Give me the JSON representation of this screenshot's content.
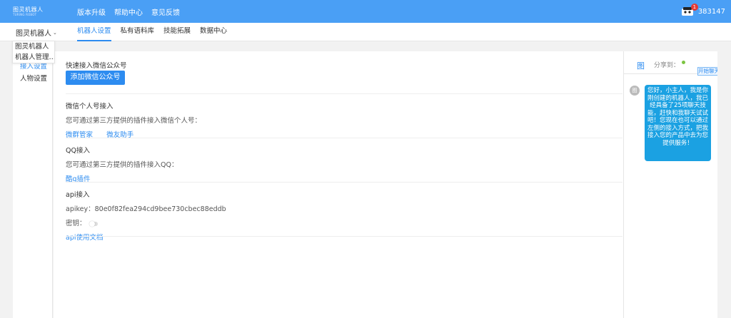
{
  "topbar": {
    "logo_line1": "图灵机器人",
    "logo_line2": "TURING ROBOT",
    "nav": [
      "版本升级",
      "帮助中心",
      "意见反馈"
    ],
    "badge_count": "1",
    "user_id": "383147",
    "bg_color": "#4a9ff5"
  },
  "subbar": {
    "robot_name": "图灵机器人",
    "tabs": [
      "机器人设置",
      "私有语料库",
      "技能拓展",
      "数据中心"
    ],
    "active_tab": "机器人设置"
  },
  "robot_dropdown": {
    "items": [
      "图灵机器人",
      "机器人管理…"
    ]
  },
  "sidebar": {
    "items": [
      "接入设置",
      "人物设置"
    ]
  },
  "main": {
    "wechat_official": {
      "title": "快速接入微信公众号",
      "button": "添加微信公众号"
    },
    "wechat_personal": {
      "title": "微信个人号接入",
      "desc": "您可通过第三方提供的插件接入微信个人号：",
      "links": [
        "微群管家",
        "微友助手"
      ]
    },
    "qq": {
      "title": "QQ接入",
      "desc": "您可通过第三方提供的插件接入QQ：",
      "link": "酷q插件"
    },
    "api": {
      "title": "api接入",
      "apikey_label": "apikey：",
      "apikey_value": "80e0f82fea294cd9bee730cbec88eddb",
      "secret_label": "密钥：",
      "doc_link": "api使用文档"
    }
  },
  "chat": {
    "logo_char": "图",
    "share_label": "分享到：",
    "start_chat": "开始聊天",
    "bot_avatar": "图",
    "message": "您好，小主人，我是你刚创建的机器人，我已经具备了25项聊天技能，赶快和我聊天试试吧！您现在也可以通过左侧的接入方式，把我接入您的产品中去为您提供服务！",
    "bubble_color": "#1ba1e2"
  }
}
